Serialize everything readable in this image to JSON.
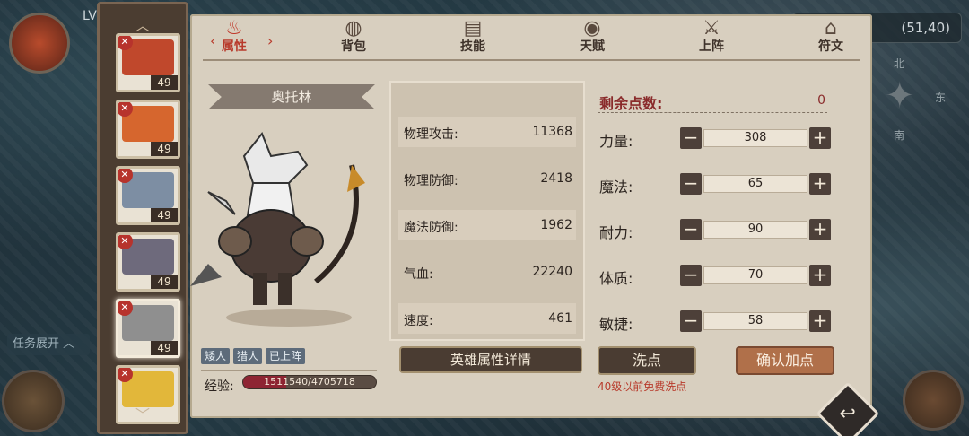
{
  "hud": {
    "level_prefix": "LV",
    "task_toggle": "任务展开 ︿",
    "coordinates": "(51,40)",
    "compass": {
      "north": "北",
      "east": "东",
      "south": "南"
    }
  },
  "sidebar": {
    "heroes": [
      {
        "level": "49",
        "face_color": "#c0482c"
      },
      {
        "level": "49",
        "face_color": "#d6662e"
      },
      {
        "level": "49",
        "face_color": "#7d8ea3"
      },
      {
        "level": "49",
        "face_color": "#6e6a7c"
      },
      {
        "level": "49",
        "face_color": "#8f8f8f",
        "selected": true
      },
      {
        "level": "",
        "face_color": "#e2b73a"
      }
    ]
  },
  "tabs": [
    {
      "label": "属性",
      "icon": "flame-icon",
      "active": true
    },
    {
      "label": "背包",
      "icon": "bag-icon"
    },
    {
      "label": "技能",
      "icon": "book-icon"
    },
    {
      "label": "天赋",
      "icon": "eye-icon"
    },
    {
      "label": "上阵",
      "icon": "swords-icon"
    },
    {
      "label": "符文",
      "icon": "rune-icon"
    }
  ],
  "hero": {
    "name": "奥托林",
    "tags": [
      "矮人",
      "猎人",
      "已上阵"
    ],
    "exp_label": "经验:",
    "exp_text": "1511540/4705718",
    "exp_fraction": 0.3212
  },
  "stats": [
    {
      "label": "物理攻击:",
      "value": "11368"
    },
    {
      "label": "物理防御:",
      "value": "2418"
    },
    {
      "label": "魔法防御:",
      "value": "1962"
    },
    {
      "label": "气血:",
      "value": "22240"
    },
    {
      "label": "速度:",
      "value": "461"
    }
  ],
  "detail_button": "英雄属性详情",
  "points": {
    "label": "剩余点数:",
    "value": "0"
  },
  "attributes": [
    {
      "label": "力量:",
      "value": "308"
    },
    {
      "label": "魔法:",
      "value": "65"
    },
    {
      "label": "耐力:",
      "value": "90"
    },
    {
      "label": "体质:",
      "value": "70"
    },
    {
      "label": "敏捷:",
      "value": "58"
    }
  ],
  "wash_button": "洗点",
  "wash_note": "40级以前免费洗点",
  "confirm_button": "确认加点"
}
